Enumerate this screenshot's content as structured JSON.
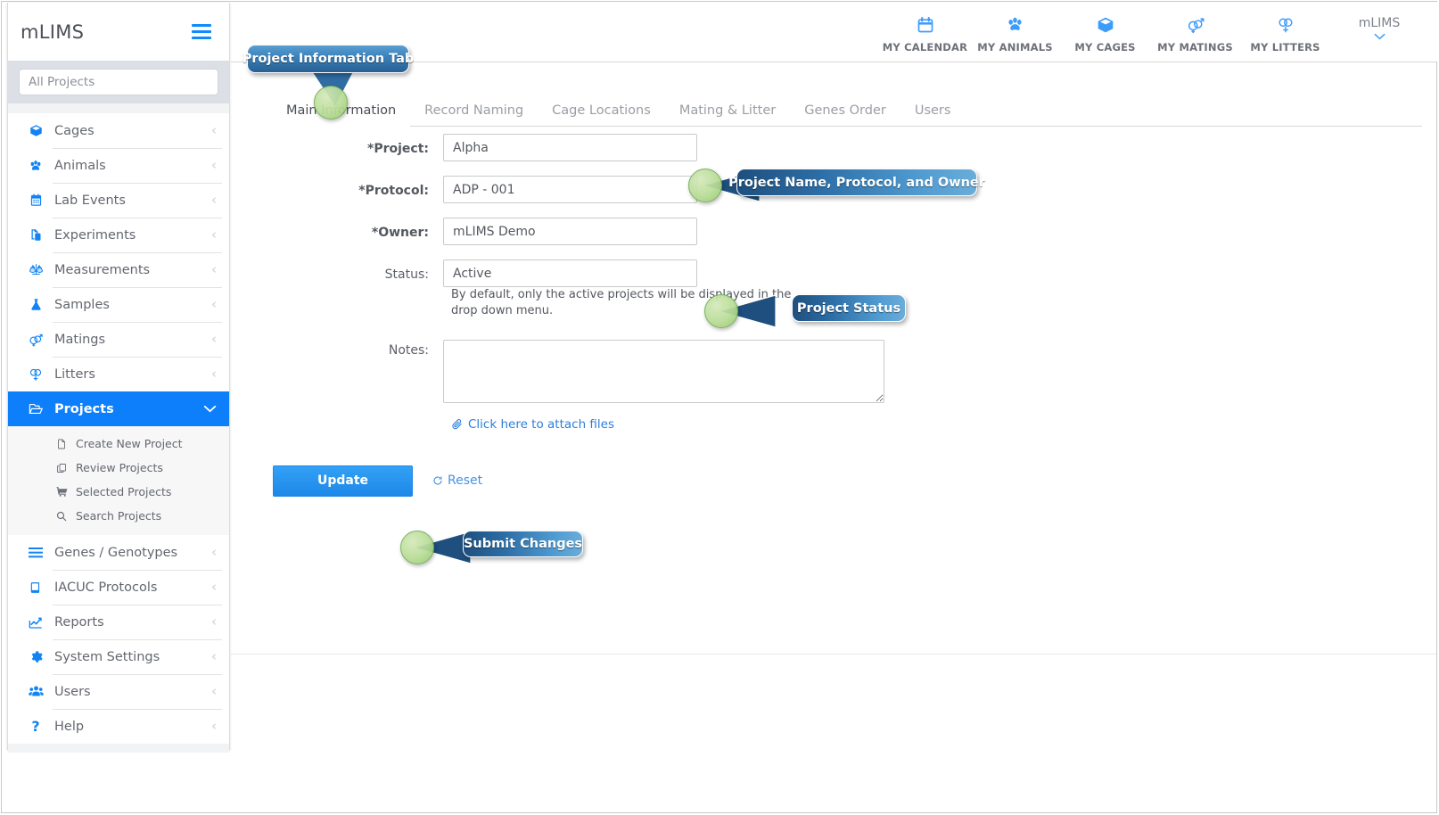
{
  "app": {
    "brand": "mLIMS",
    "user_name": "mLIMS"
  },
  "sidebar": {
    "search_placeholder": "All Projects",
    "items": [
      {
        "label": "Cages",
        "icon": "cube-icon"
      },
      {
        "label": "Animals",
        "icon": "paw-icon"
      },
      {
        "label": "Lab Events",
        "icon": "calendar-icon"
      },
      {
        "label": "Experiments",
        "icon": "flask-doc-icon"
      },
      {
        "label": "Measurements",
        "icon": "balance-scale-icon"
      },
      {
        "label": "Samples",
        "icon": "flask-icon"
      },
      {
        "label": "Matings",
        "icon": "mating-icon"
      },
      {
        "label": "Litters",
        "icon": "litters-icon"
      },
      {
        "label": "Projects",
        "icon": "folder-open-icon",
        "active": true
      },
      {
        "label": "Genes / Genotypes",
        "icon": "bars-icon"
      },
      {
        "label": "IACUC Protocols",
        "icon": "book-icon"
      },
      {
        "label": "Reports",
        "icon": "chart-line-icon"
      },
      {
        "label": "System Settings",
        "icon": "gear-icon"
      },
      {
        "label": "Users",
        "icon": "users-icon"
      },
      {
        "label": "Help",
        "icon": "question-icon"
      }
    ],
    "projects_submenu": [
      {
        "label": "Create New Project",
        "icon": "file-icon"
      },
      {
        "label": "Review Projects",
        "icon": "copy-icon"
      },
      {
        "label": "Selected Projects",
        "icon": "cart-icon"
      },
      {
        "label": "Search Projects",
        "icon": "search-icon"
      }
    ]
  },
  "topnav": {
    "items": [
      {
        "label": "MY CALENDAR",
        "icon": "calendar-icon"
      },
      {
        "label": "MY ANIMALS",
        "icon": "paw-icon"
      },
      {
        "label": "MY CAGES",
        "icon": "cube-icon"
      },
      {
        "label": "MY MATINGS",
        "icon": "mating-icon"
      },
      {
        "label": "MY LITTERS",
        "icon": "litters-icon"
      }
    ]
  },
  "tabs": [
    {
      "label": "Main Information",
      "active": true
    },
    {
      "label": "Record Naming",
      "active": false
    },
    {
      "label": "Cage Locations",
      "active": false
    },
    {
      "label": "Mating & Litter",
      "active": false
    },
    {
      "label": "Genes Order",
      "active": false
    },
    {
      "label": "Users",
      "active": false
    }
  ],
  "form": {
    "project_label": "*Project:",
    "project_value": "Alpha",
    "protocol_label": "*Protocol:",
    "protocol_value": "ADP - 001",
    "owner_label": "*Owner:",
    "owner_value": "mLIMS Demo",
    "status_label": "Status:",
    "status_value": "Active",
    "status_hint": "By default, only the active projects will be displayed in the drop down menu.",
    "notes_label": "Notes:",
    "notes_value": "",
    "attach_label": "Click here to attach files",
    "update_label": "Update",
    "reset_label": "Reset"
  },
  "callouts": {
    "tab": "Project Information Tab",
    "fields": "Project Name, Protocol,  and Owner",
    "status": "Project Status",
    "submit": "Submit Changes"
  },
  "colors": {
    "accent": "#0d7ffb",
    "icon_blue": "#1183f5",
    "callout_blue": "#2d6ea6",
    "marker_green": "#b8dc96"
  }
}
